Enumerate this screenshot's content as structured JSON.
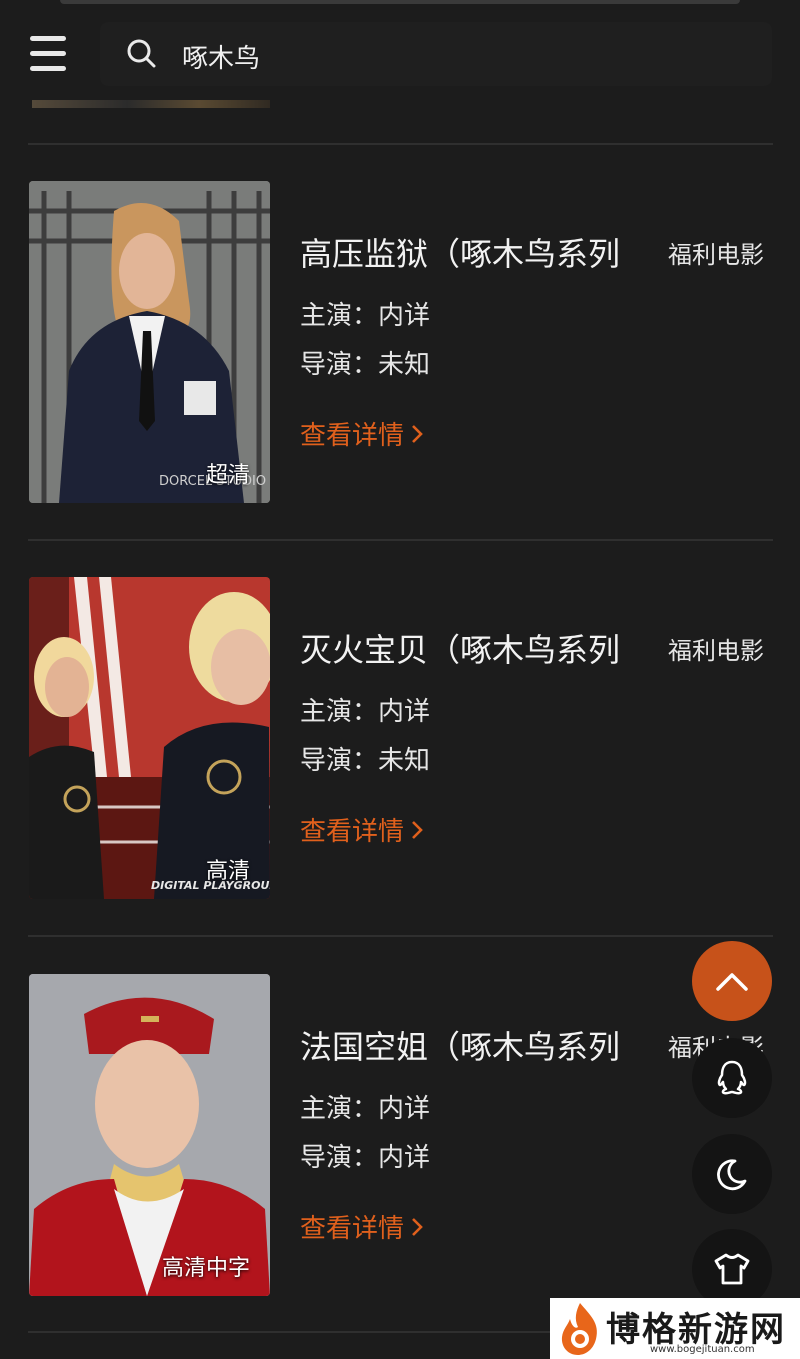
{
  "search": {
    "query": "啄木鸟"
  },
  "results": [
    {
      "title": "高压监狱（啄木鸟系列",
      "category": "福利电影",
      "cast_label": "主演：",
      "cast": "内详",
      "director_label": "导演：",
      "director": "未知",
      "detail_label": "查看详情",
      "quality": "超清",
      "poster_text": "DORCEL STUDIO"
    },
    {
      "title": "灭火宝贝（啄木鸟系列",
      "category": "福利电影",
      "cast_label": "主演：",
      "cast": "内详",
      "director_label": "导演：",
      "director": "未知",
      "detail_label": "查看详情",
      "quality": "高清",
      "poster_text": "DIGITAL PLAYGROUND"
    },
    {
      "title": "法国空姐（啄木鸟系列",
      "category": "福利电影",
      "cast_label": "主演：",
      "cast": "内详",
      "director_label": "导演：",
      "director": "内详",
      "detail_label": "查看详情",
      "quality": "高清中字",
      "poster_text": ""
    }
  ],
  "floating_buttons": [
    "back-to-top",
    "qq-icon",
    "moon-icon",
    "shirt-icon"
  ],
  "watermark": {
    "text": "博格新游网",
    "url": "www.bogejituan.com"
  },
  "colors": {
    "background": "#1c1c1c",
    "accent": "#e0601c",
    "fab": "#c7521a",
    "text": "#e6e6e6"
  }
}
